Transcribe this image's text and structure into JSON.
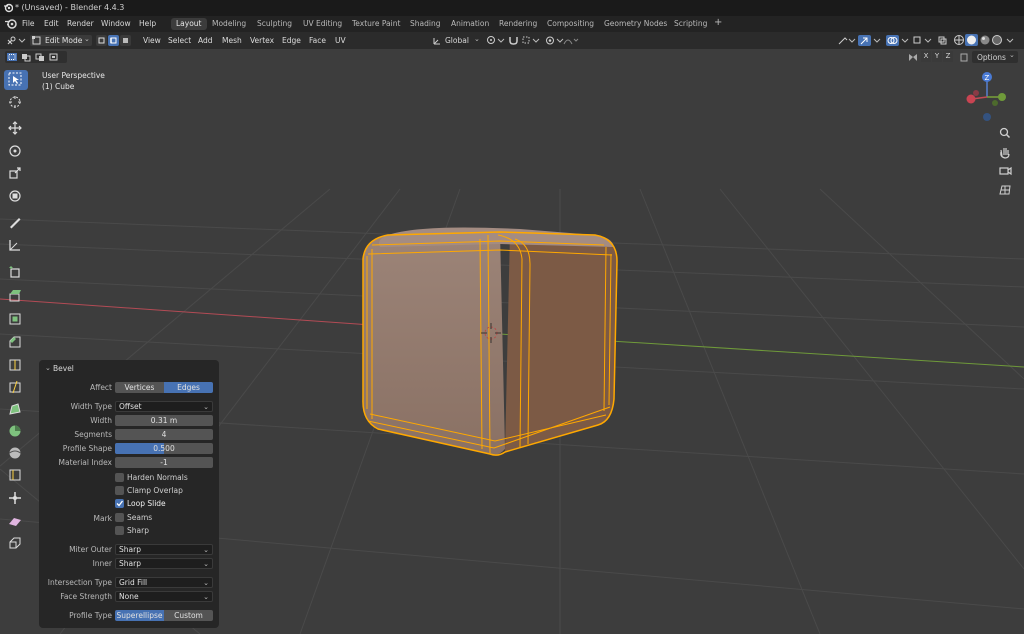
{
  "window": {
    "title": "* (Unsaved) - Blender 4.4.3"
  },
  "menu": [
    "File",
    "Edit",
    "Render",
    "Window",
    "Help"
  ],
  "workspaces": [
    "Layout",
    "Modeling",
    "Sculpting",
    "UV Editing",
    "Texture Paint",
    "Shading",
    "Animation",
    "Rendering",
    "Compositing",
    "Geometry Nodes",
    "Scripting",
    "+"
  ],
  "active_workspace": "Layout",
  "header": {
    "mode": "Edit Mode",
    "menus": [
      "View",
      "Select",
      "Add",
      "Mesh",
      "Vertex",
      "Edge",
      "Face",
      "UV"
    ],
    "transform_orientation": "Global",
    "options_label": "Options",
    "axes": [
      "X",
      "Y",
      "Z"
    ]
  },
  "viewport": {
    "perspective_label": "User Perspective",
    "object_label": "(1) Cube",
    "gizmo_z": "Z"
  },
  "bevel_panel": {
    "title": "Bevel",
    "affect_label": "Affect",
    "affect_options": [
      "Vertices",
      "Edges"
    ],
    "affect_selected": "Edges",
    "width_type_label": "Width Type",
    "width_type": "Offset",
    "width_label": "Width",
    "width": "0.31 m",
    "segments_label": "Segments",
    "segments": "4",
    "profile_shape_label": "Profile Shape",
    "profile_shape": "0.500",
    "profile_shape_fill": 0.5,
    "material_index_label": "Material Index",
    "material_index": "-1",
    "harden_normals": {
      "label": "Harden Normals",
      "checked": false
    },
    "clamp_overlap": {
      "label": "Clamp Overlap",
      "checked": false
    },
    "loop_slide": {
      "label": "Loop Slide",
      "checked": true
    },
    "mark_label": "Mark",
    "mark_seams": {
      "label": "Seams",
      "checked": false
    },
    "mark_sharp": {
      "label": "Sharp",
      "checked": false
    },
    "miter_outer_label": "Miter Outer",
    "miter_outer": "Sharp",
    "inner_label": "Inner",
    "inner": "Sharp",
    "intersection_type_label": "Intersection Type",
    "intersection_type": "Grid Fill",
    "face_strength_label": "Face Strength",
    "face_strength": "None",
    "profile_type_label": "Profile Type",
    "profile_type_options": [
      "Superellipse",
      "Custom"
    ],
    "profile_type_selected": "Superellipse"
  },
  "colors": {
    "accent": "#4772b3",
    "selection": "#ffa800",
    "viewport_bg": "#3d3d3d",
    "x_axis": "#b34b55",
    "y_axis": "#6f9a3a"
  }
}
